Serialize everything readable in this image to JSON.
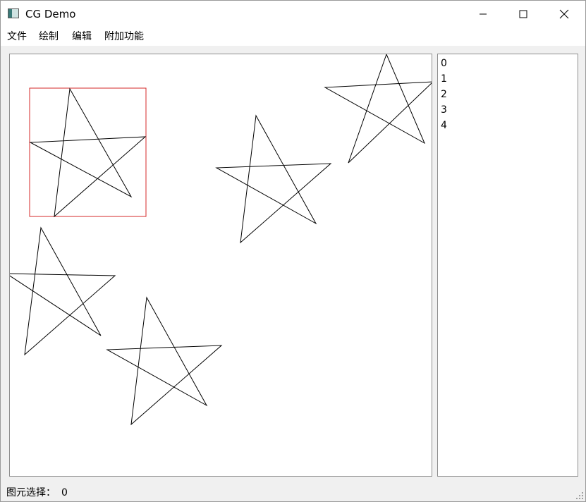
{
  "window": {
    "title": "CG Demo"
  },
  "titlebar": {
    "app_icon": "app-window-icon",
    "minimize_icon": "minimize-icon",
    "maximize_icon": "maximize-icon",
    "close_icon": "close-icon"
  },
  "menubar": {
    "items": [
      {
        "label": "文件"
      },
      {
        "label": "绘制"
      },
      {
        "label": "编辑"
      },
      {
        "label": "附加功能"
      }
    ]
  },
  "item_list": {
    "items": [
      "0",
      "1",
      "2",
      "3",
      "4"
    ]
  },
  "status": {
    "label": "图元选择：",
    "value": "0"
  },
  "colors": {
    "selection_box": "#d42a2a",
    "stroke": "#000000",
    "canvas_background": "#ffffff",
    "window_background": "#f0f0f0"
  }
}
